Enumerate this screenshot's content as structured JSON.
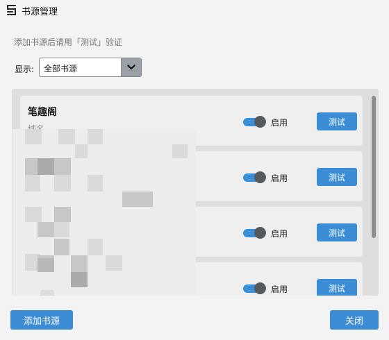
{
  "window": {
    "title": "书源管理",
    "icon": "book-source-icon"
  },
  "hint": "添加书源后请用「测试」验证",
  "filter": {
    "label": "显示:",
    "selected": "全部书源",
    "icon": "chevron-down-icon"
  },
  "sources": [
    {
      "name": "笔趣阁",
      "domain": "域名",
      "toggle_label": "启用",
      "enabled": true,
      "test_label": "测试"
    },
    {
      "name": "",
      "domain": "",
      "toggle_label": "启用",
      "enabled": true,
      "test_label": "测试"
    },
    {
      "name": "",
      "domain": "",
      "toggle_label": "启用",
      "enabled": true,
      "test_label": "测试"
    },
    {
      "name": "",
      "domain": "域名",
      "toggle_label": "启用",
      "enabled": true,
      "test_label": "测试"
    }
  ],
  "footer": {
    "add_label": "添加书源",
    "close_label": "关闭"
  },
  "colors": {
    "accent": "#3d8dd6",
    "toggle_on": "#3a8fd9",
    "background": "#f3f3f3",
    "panel": "#dedede"
  }
}
